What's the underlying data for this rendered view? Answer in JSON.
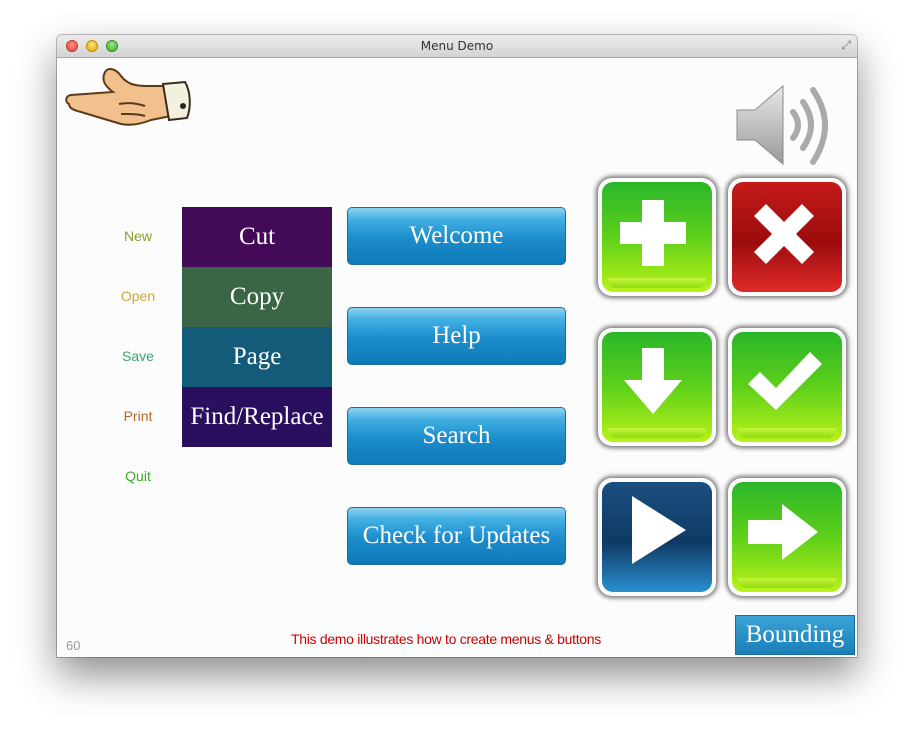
{
  "window": {
    "title": "Menu Demo"
  },
  "side_menu": [
    {
      "label": "New",
      "color": "#8a9a2a"
    },
    {
      "label": "Open",
      "color": "#c9a93a"
    },
    {
      "label": "Save",
      "color": "#3aa66a"
    },
    {
      "label": "Print",
      "color": "#b06a2a"
    },
    {
      "label": "Quit",
      "color": "#3aaa2a"
    }
  ],
  "vertical_menu": [
    {
      "label": "Cut",
      "color": "#430a57"
    },
    {
      "label": "Copy",
      "color": "#3a6645"
    },
    {
      "label": "Page",
      "color": "#145b7a"
    },
    {
      "label": "Find/Replace",
      "color": "#2a0f5e"
    }
  ],
  "blue_buttons": [
    {
      "label": "Welcome"
    },
    {
      "label": "Help"
    },
    {
      "label": "Search"
    },
    {
      "label": "Check for Updates"
    }
  ],
  "icon_buttons": [
    {
      "icon": "plus-icon",
      "style": "green"
    },
    {
      "icon": "close-x-icon",
      "style": "red"
    },
    {
      "icon": "arrow-down-icon",
      "style": "green"
    },
    {
      "icon": "checkmark-icon",
      "style": "green"
    },
    {
      "icon": "play-icon",
      "style": "blue"
    },
    {
      "icon": "arrow-right-icon",
      "style": "green"
    }
  ],
  "footer": {
    "message": "This demo illustrates how to create menus & buttons",
    "fps": "60",
    "bounding_label": "Bounding"
  },
  "colors": {
    "accent_blue": "#1c8ccb",
    "footer_text": "#cc0000"
  }
}
